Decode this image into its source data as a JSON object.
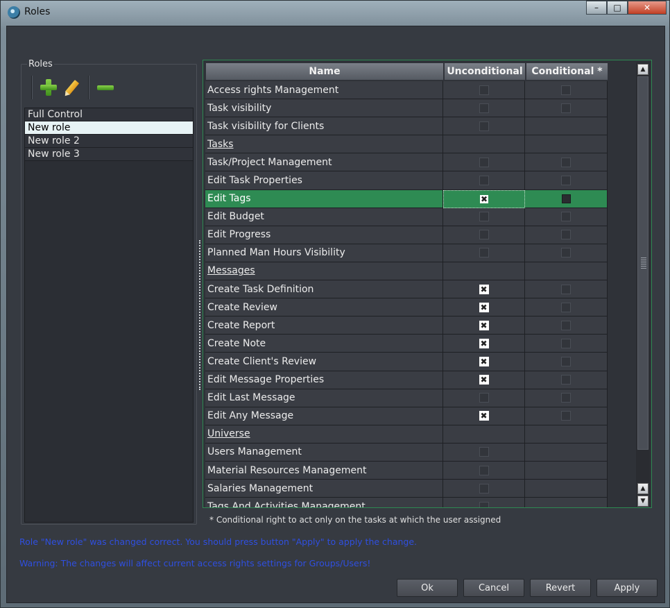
{
  "window": {
    "title": "Roles"
  },
  "roles_panel": {
    "label": "Roles",
    "roles": [
      "Full Control",
      "New role",
      "New role 2",
      "New role 3"
    ],
    "selected_index": 1
  },
  "table": {
    "columns": [
      "Name",
      "Unconditional",
      "Conditional *"
    ],
    "rows": [
      {
        "name": "Access rights Management",
        "section": false,
        "u": "off",
        "c": "off"
      },
      {
        "name": "Task visibility",
        "section": false,
        "u": "off",
        "c": "off"
      },
      {
        "name": "Task visibility for Clients",
        "section": false,
        "u": "off",
        "c": "none"
      },
      {
        "name": "Tasks",
        "section": true,
        "u": "none",
        "c": "none"
      },
      {
        "name": "Task/Project Management",
        "section": false,
        "u": "off",
        "c": "off"
      },
      {
        "name": "Edit Task Properties",
        "section": false,
        "u": "off",
        "c": "off"
      },
      {
        "name": "Edit Tags",
        "section": false,
        "u": "on",
        "c": "partial",
        "selected": true
      },
      {
        "name": "Edit Budget",
        "section": false,
        "u": "off",
        "c": "off"
      },
      {
        "name": "Edit Progress",
        "section": false,
        "u": "off",
        "c": "off"
      },
      {
        "name": "Planned Man Hours Visibility",
        "section": false,
        "u": "off",
        "c": "off"
      },
      {
        "name": "Messages",
        "section": true,
        "u": "none",
        "c": "none"
      },
      {
        "name": "Create Task Definition",
        "section": false,
        "u": "on",
        "c": "off"
      },
      {
        "name": "Create Review",
        "section": false,
        "u": "on",
        "c": "off"
      },
      {
        "name": "Create Report",
        "section": false,
        "u": "on",
        "c": "off"
      },
      {
        "name": "Create Note",
        "section": false,
        "u": "on",
        "c": "off"
      },
      {
        "name": "Create Client's Review",
        "section": false,
        "u": "on",
        "c": "off"
      },
      {
        "name": "Edit Message Properties",
        "section": false,
        "u": "on",
        "c": "off"
      },
      {
        "name": "Edit Last Message",
        "section": false,
        "u": "off",
        "c": "off"
      },
      {
        "name": "Edit Any Message",
        "section": false,
        "u": "on",
        "c": "off"
      },
      {
        "name": "Universe",
        "section": true,
        "u": "none",
        "c": "none"
      },
      {
        "name": "Users Management",
        "section": false,
        "u": "off",
        "c": "none"
      },
      {
        "name": "Material Resources Management",
        "section": false,
        "u": "off",
        "c": "none"
      },
      {
        "name": "Salaries Management",
        "section": false,
        "u": "off",
        "c": "none"
      },
      {
        "name": "Tags And Activities Management",
        "section": false,
        "u": "off",
        "c": "none"
      }
    ]
  },
  "footnote": "* Conditional right to act only on the tasks at which the user assigned",
  "status": {
    "changed": "Role \"New role\" was changed correct. You should press button \"Apply\" to apply the change.",
    "warning": "Warning: The changes will affect current access rights settings for Groups/Users!"
  },
  "buttons": {
    "ok": "Ok",
    "cancel": "Cancel",
    "revert": "Revert",
    "apply": "Apply"
  },
  "titlebar_buttons": {
    "minimize": "–",
    "maximize": "□",
    "close": "✕"
  },
  "check_mark": "✖",
  "colors": {
    "selection": "#2e8b53",
    "status_text": "#2f4fe0",
    "accent_green": "#5fb332"
  }
}
